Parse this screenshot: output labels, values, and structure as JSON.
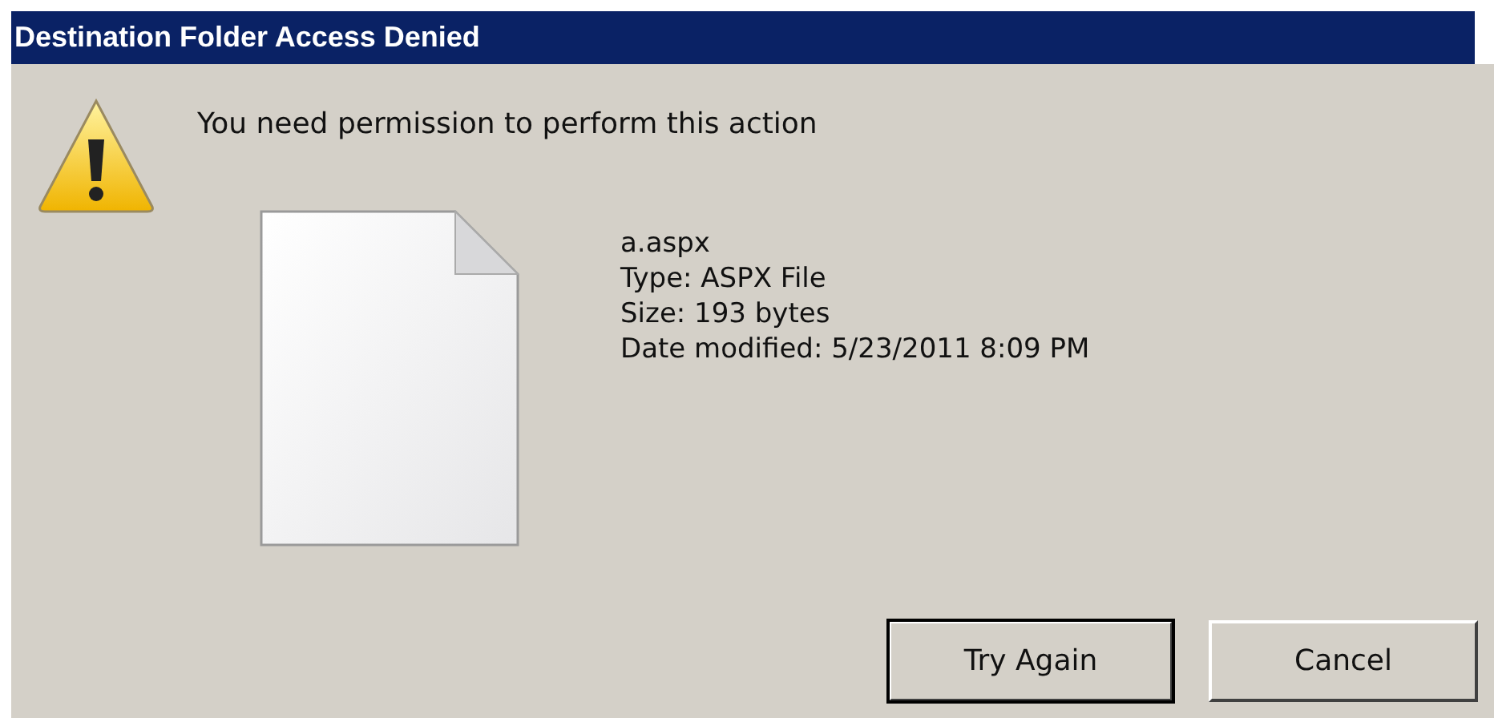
{
  "window": {
    "title": "Destination Folder Access Denied"
  },
  "message": "You need permission to perform this action",
  "file": {
    "name": "a.aspx",
    "details": [
      "Type: ASPX File",
      "Size: 193 bytes",
      "Date modified: 5/23/2011 8:09 PM"
    ]
  },
  "buttons": [
    {
      "label": "Try Again",
      "default": true
    },
    {
      "label": "Cancel",
      "default": false
    }
  ]
}
